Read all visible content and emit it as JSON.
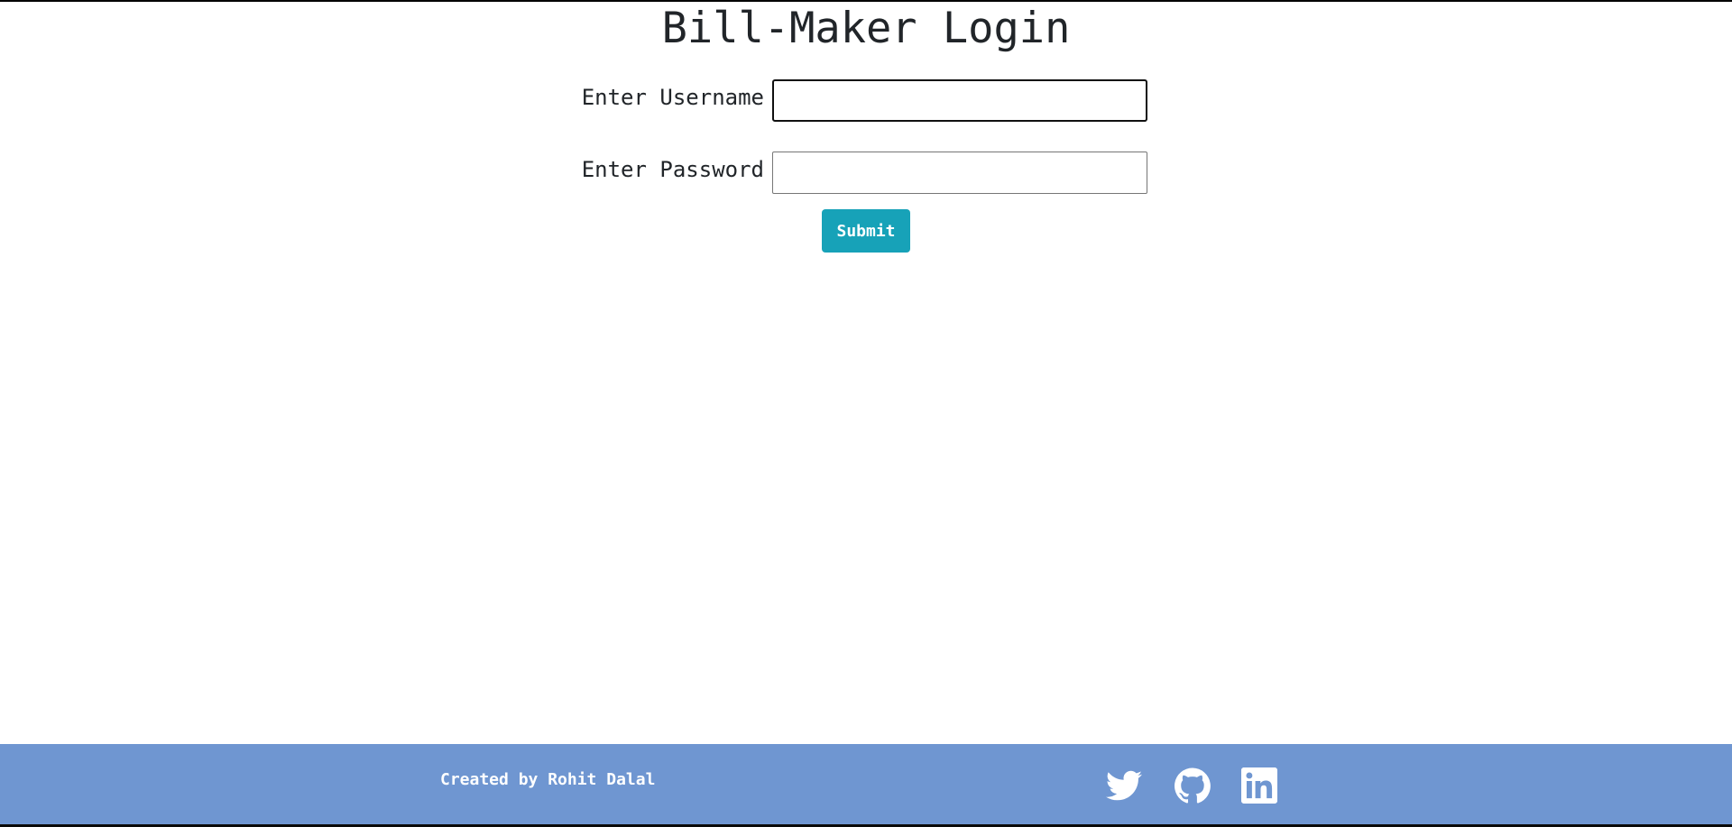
{
  "page": {
    "title": "Bill-Maker Login"
  },
  "form": {
    "username_label": "Enter Username",
    "username_value": "",
    "password_label": "Enter Password",
    "password_value": "",
    "submit_label": "Submit"
  },
  "footer": {
    "credit": "Created by Rohit Dalal",
    "social_links": [
      "twitter-icon",
      "github-icon",
      "linkedin-icon"
    ]
  },
  "colors": {
    "accent_button": "#17a2b8",
    "footer_background": "#6f96d1",
    "footer_text": "#ffffff"
  }
}
